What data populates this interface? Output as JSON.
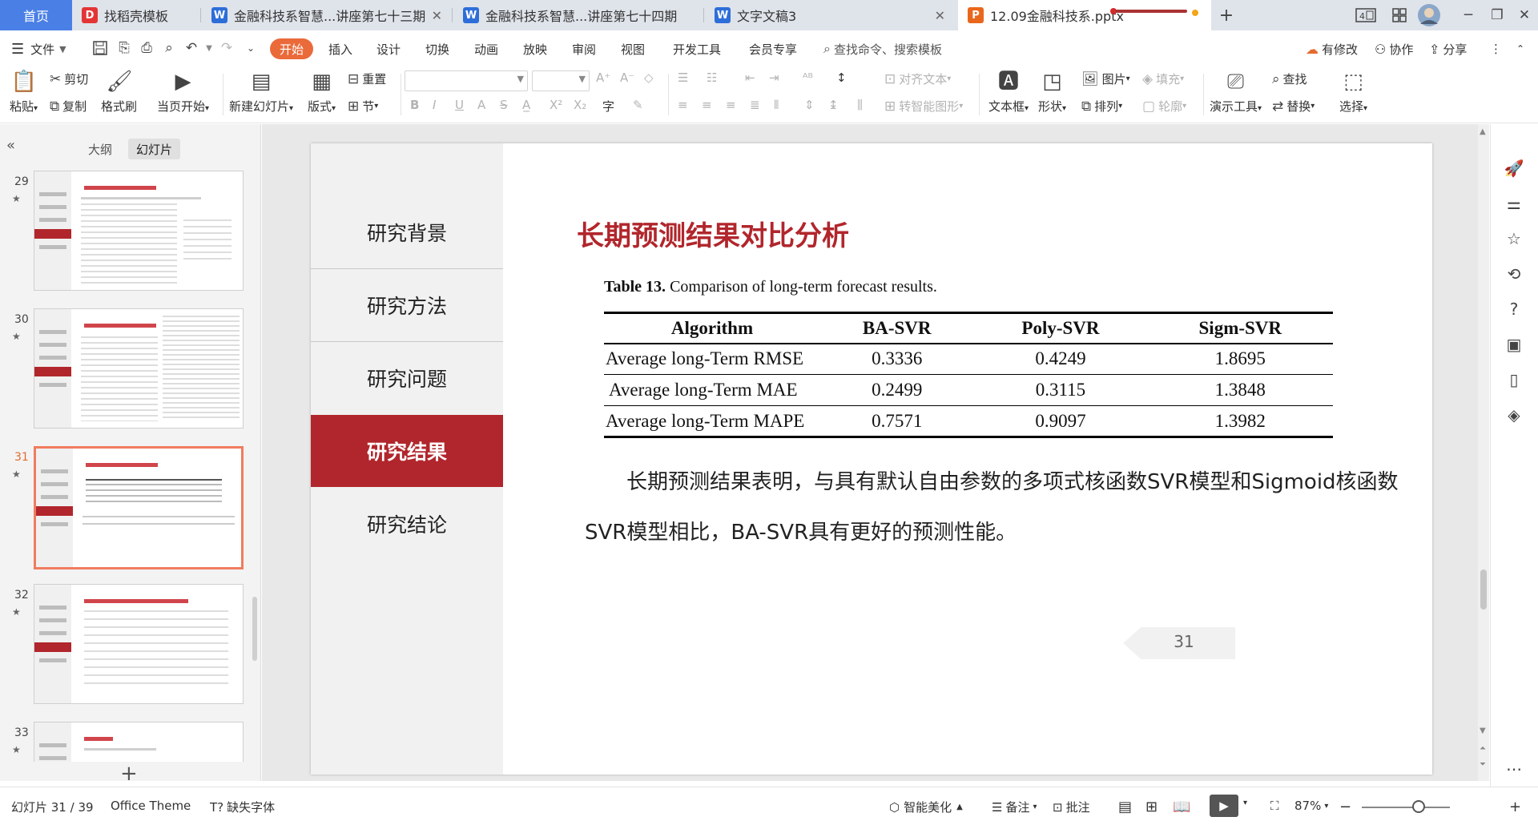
{
  "tabs": [
    {
      "label": "首页"
    },
    {
      "label": "找稻壳模板",
      "icon": "docer-icon",
      "color": "#e43535",
      "glyph": "D"
    },
    {
      "label": "金融科技系智慧...讲座第七十三期",
      "icon": "wps-writer-icon",
      "color": "#2d6ed9",
      "glyph": "W"
    },
    {
      "label": "金融科技系智慧...讲座第七十四期",
      "icon": "wps-writer-icon",
      "color": "#2d6ed9",
      "glyph": "W"
    },
    {
      "label": "文字文稿3",
      "icon": "wps-writer-icon",
      "color": "#2d6ed9",
      "glyph": "W"
    },
    {
      "label": "12.09金融科技系.pptx",
      "icon": "wps-presentation-icon",
      "color": "#e8671c",
      "glyph": "P"
    }
  ],
  "menu": {
    "file": "文件",
    "items": [
      "开始",
      "插入",
      "设计",
      "切换",
      "动画",
      "放映",
      "审阅",
      "视图",
      "开发工具",
      "会员专享"
    ],
    "search": "查找命令、搜索模板",
    "has_changes": "有修改",
    "collab": "协作",
    "share": "分享"
  },
  "ribbon": {
    "paste": "粘贴",
    "cut": "剪切",
    "copy": "复制",
    "format_painter": "格式刷",
    "from_current": "当页开始",
    "new_slide": "新建幻灯片",
    "layout": "版式",
    "section": "节",
    "reset": "重置",
    "align_text": "对齐文本",
    "smart_graphic": "转智能图形",
    "textbox": "文本框",
    "shape": "形状",
    "arrange": "排列",
    "picture": "图片",
    "fill": "填充",
    "outline": "轮廓",
    "present_tools": "演示工具",
    "find": "查找",
    "replace": "替换",
    "select": "选择"
  },
  "left_panel": {
    "tab_outline": "大纲",
    "tab_slides": "幻灯片",
    "thumbs": [
      {
        "num": "29"
      },
      {
        "num": "30"
      },
      {
        "num": "31"
      },
      {
        "num": "32"
      },
      {
        "num": "33"
      }
    ]
  },
  "slide": {
    "nav": [
      "研究背景",
      "研究方法",
      "研究问题",
      "研究结果",
      "研究结论"
    ],
    "selected_nav": "研究结果",
    "title": "长期预测结果对比分析",
    "caption_bold": "Table 13.",
    "caption_text": " Comparison of long-term forecast results.",
    "table": {
      "headers": [
        "Algorithm",
        "BA-SVR",
        "Poly-SVR",
        "Sigm-SVR"
      ],
      "rows": [
        [
          "Average long-Term RMSE",
          "0.3336",
          "0.4249",
          "1.8695"
        ],
        [
          "Average long-Term MAE",
          "0.2499",
          "0.3115",
          "1.3848"
        ],
        [
          "Average long-Term MAPE",
          "0.7571",
          "0.9097",
          "1.3982"
        ]
      ]
    },
    "paragraph": "长期预测结果表明，与具有默认自由参数的多项式核函数SVR模型和Sigmoid核函数SVR模型相比，BA-SVR具有更好的预测性能。",
    "page_number": "31"
  },
  "status": {
    "slide_pos": "幻灯片 31 / 39",
    "theme": "Office Theme",
    "missing_fonts": "缺失字体",
    "beautify": "智能美化",
    "notes": "备注",
    "comments": "批注",
    "zoom": "87%"
  },
  "colors": {
    "accent_red": "#b1262c",
    "start_orange": "#ea6a3a",
    "home_tab_blue": "#4a7fe6"
  }
}
